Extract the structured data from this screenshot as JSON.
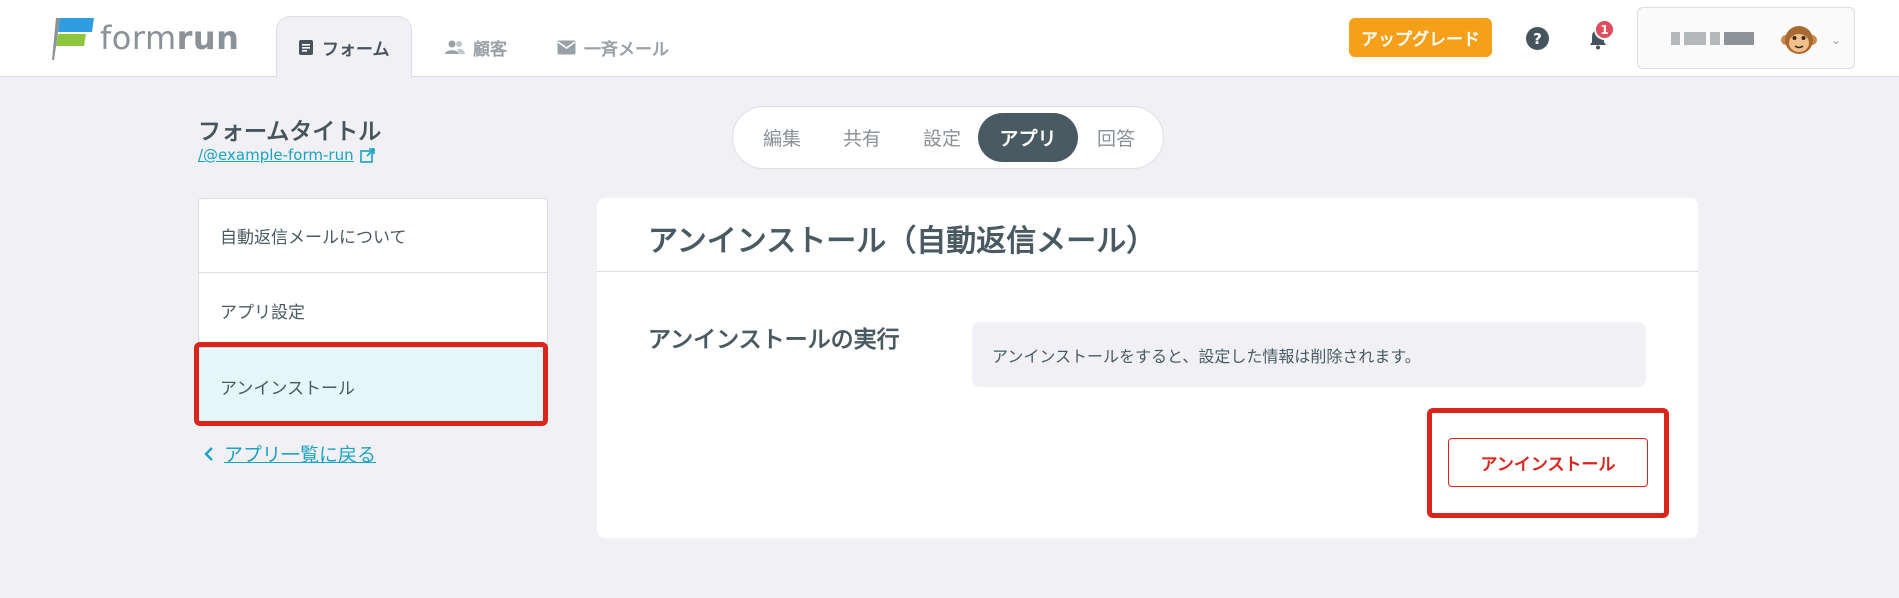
{
  "header": {
    "logo_text_light": "form",
    "logo_text_bold": "run",
    "nav": [
      {
        "label": "フォーム",
        "icon": "document-icon"
      },
      {
        "label": "顧客",
        "icon": "people-icon"
      },
      {
        "label": "一斉メール",
        "icon": "mail-icon"
      }
    ],
    "upgrade_label": "アップグレード",
    "help_glyph": "?",
    "notification_count": "1",
    "user_avatar": "monkey-avatar"
  },
  "form": {
    "title": "フォームタイトル",
    "link": "/@example-form-run"
  },
  "segment_tabs": [
    "編集",
    "共有",
    "設定",
    "アプリ",
    "回答"
  ],
  "segment_active": "アプリ",
  "sidebar": {
    "items": [
      {
        "label": "自動返信メールについて"
      },
      {
        "label": "アプリ設定"
      },
      {
        "label": "アンインストール"
      }
    ],
    "back_label": "アプリ一覧に戻る"
  },
  "main": {
    "title": "アンインストール（自動返信メール）",
    "section_title": "アンインストールの実行",
    "notice": "アンインストールをすると、設定した情報は削除されます。",
    "button_label": "アンインストール"
  },
  "colors": {
    "accent": "#1aa3c2",
    "upgrade": "#f6a01a",
    "danger": "#d9251c",
    "dark": "#4a5a63"
  }
}
